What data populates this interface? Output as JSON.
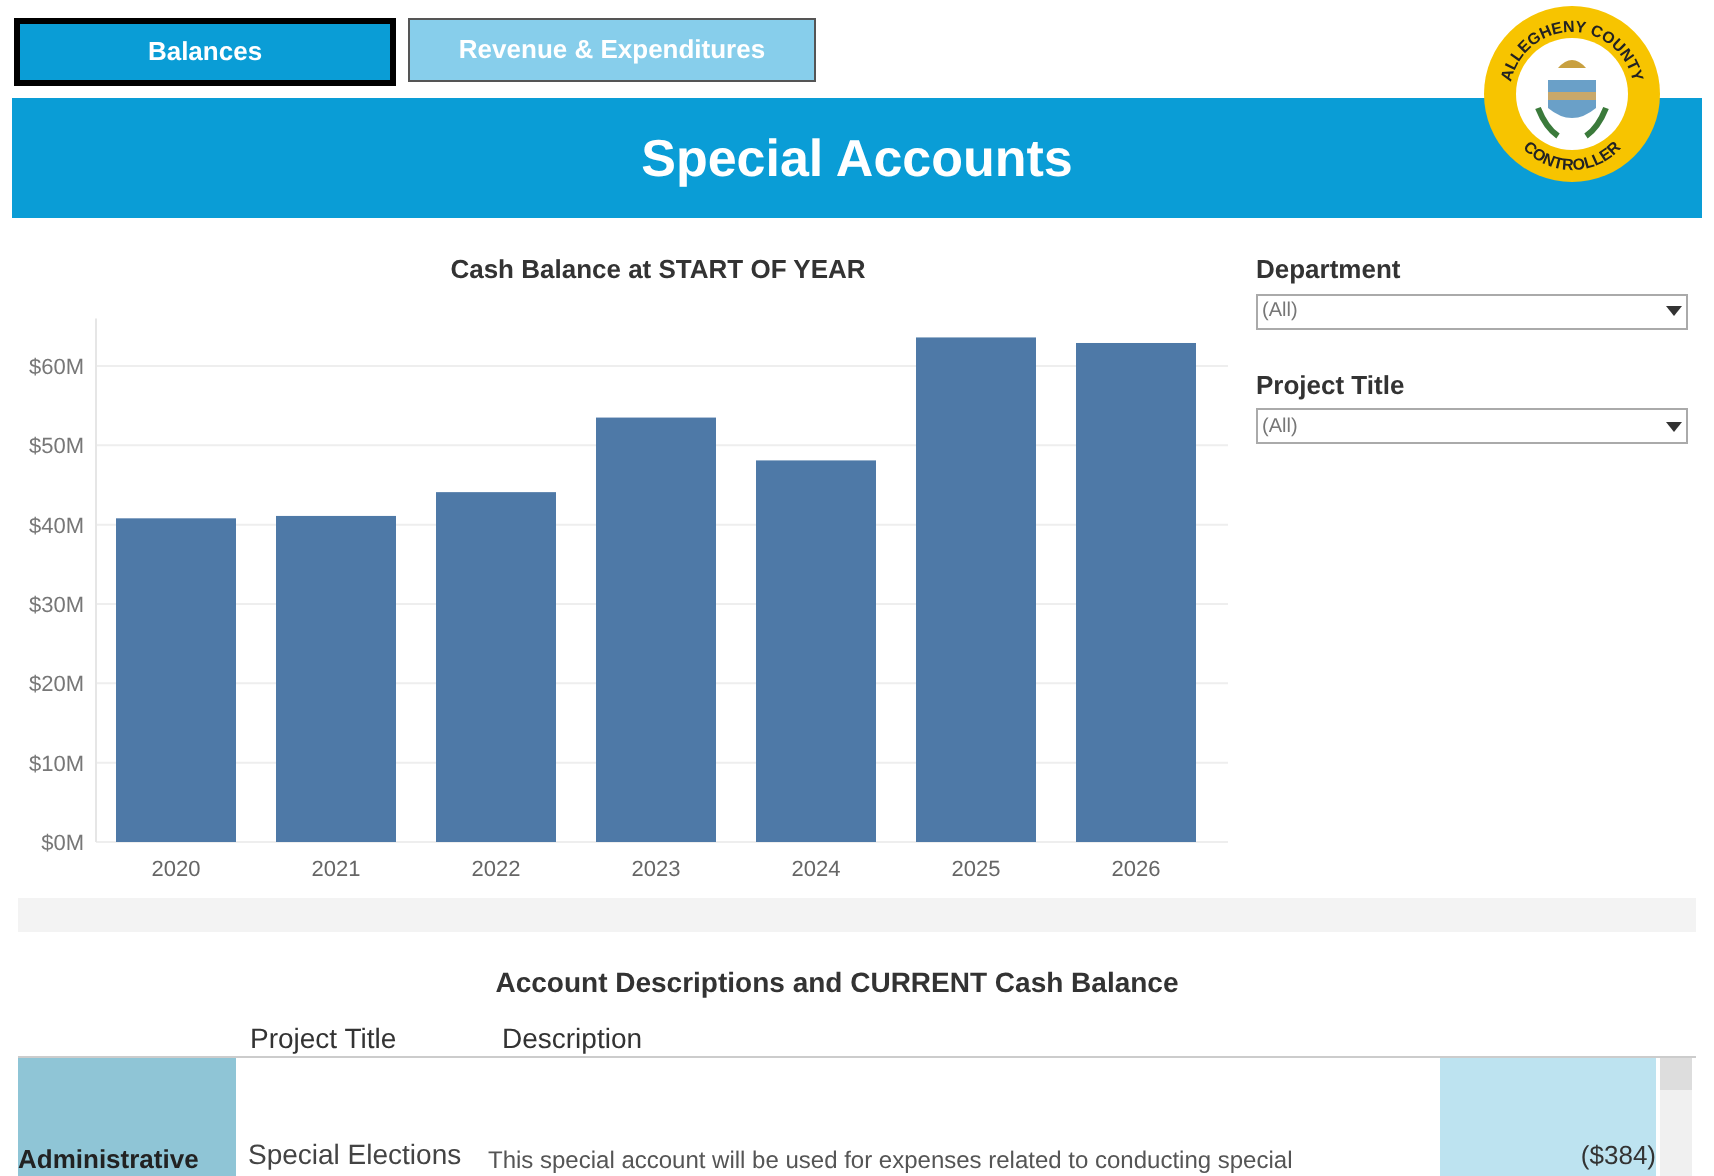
{
  "tabs": [
    {
      "label": "Balances",
      "selected": true
    },
    {
      "label": "Revenue & Expenditures",
      "selected": false
    }
  ],
  "header": {
    "title": "Special Accounts",
    "logo": {
      "top_text": "ALLEGHENY COUNTY",
      "bottom_text": "CONTROLLER"
    }
  },
  "chart": {
    "title": "Cash Balance at START OF YEAR",
    "chart_data": {
      "type": "bar",
      "categories": [
        "2020",
        "2021",
        "2022",
        "2023",
        "2024",
        "2025",
        "2026"
      ],
      "grid": true,
      "series": [
        {
          "color": "#4e79a7",
          "values": [
            40800000,
            41100000,
            44100000,
            53500000,
            48100000,
            63600000,
            62900000
          ]
        }
      ],
      "ylim": [
        0,
        66000000
      ],
      "yticks": [
        {
          "value": 0,
          "label": "$0M"
        },
        {
          "value": 10000000,
          "label": "$10M"
        },
        {
          "value": 20000000,
          "label": "$20M"
        },
        {
          "value": 30000000,
          "label": "$30M"
        },
        {
          "value": 40000000,
          "label": "$40M"
        },
        {
          "value": 50000000,
          "label": "$50M"
        },
        {
          "value": 60000000,
          "label": "$60M"
        }
      ]
    }
  },
  "filters": [
    {
      "label": "Department",
      "value": "(All)"
    },
    {
      "label": "Project Title",
      "value": "(All)"
    }
  ],
  "table": {
    "title": "Account Descriptions and CURRENT Cash Balance",
    "columns": [
      "Project Title",
      "Description"
    ],
    "rows": [
      {
        "department": "Administrative",
        "project_title": "Special Elections",
        "description": "This special account will be used for expenses related to conducting special",
        "balance": "($384)"
      }
    ]
  }
}
